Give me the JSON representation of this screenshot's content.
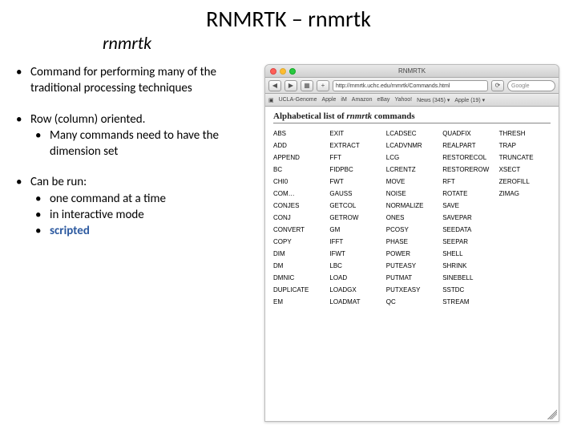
{
  "title": "RNMRTK – rnmrtk",
  "subtitle": "rnmrtk",
  "bullets": [
    {
      "text": "Command for performing many of the traditional processing techniques"
    },
    {
      "text": "Row (column) oriented.",
      "sub": [
        "Many commands need to have the dimension set"
      ]
    },
    {
      "text": "Can be run:",
      "sub": [
        "one command at a time",
        "in interactive mode",
        {
          "text": "scripted",
          "cls": "scripted"
        }
      ]
    }
  ],
  "browser": {
    "window_title": "RNMRTK",
    "url": "http://rnmrtk.uchc.edu/rnmrtk/Commands.html",
    "search_placeholder": "Google",
    "bookmarks": [
      "UCLA-Genome",
      "Apple",
      "iM",
      "Amazon",
      "eBay",
      "Yahoo!",
      "News (345) ▾",
      "Apple (19) ▾"
    ],
    "page_heading_pre": "Alphabetical list of ",
    "page_heading_ital": "rnmrtk",
    "page_heading_post": " commands",
    "commands": [
      "ABS",
      "ADD",
      "APPEND",
      "BC",
      "CHI0",
      "COM…",
      "CONJES",
      "CONJ",
      "CONVERT",
      "COPY",
      "DIM",
      "DM",
      "DMNIC",
      "DUPLICATE",
      "EM",
      "",
      "EXIT",
      "EXTRACT",
      "FFT",
      "FIDPBC",
      "FWT",
      "GAUSS",
      "GETCOL",
      "GETROW",
      "GM",
      "IFFT",
      "IFWT",
      "LBC",
      "LOAD",
      "LOADGX",
      "LOADMAT",
      "",
      "LCADSEC",
      "LCADVNMR",
      "LCG",
      "LCRENTZ",
      "MOVE",
      "NOISE",
      "NORMALIZE",
      "ONES",
      "PCOSY",
      "PHASE",
      "POWER",
      "PUTEASY",
      "PUTMAT",
      "PUTXEASY",
      "QC",
      "",
      "QUADFIX",
      "REALPART",
      "RESTORECOL",
      "RESTOREROW",
      "RFT",
      "ROTATE",
      "SAVE",
      "SAVEPAR",
      "SEEDATA",
      "SEEPAR",
      "SHELL",
      "SHRINK",
      "SINEBELL",
      "SSTDC",
      "STREAM",
      "",
      "THRESH",
      "TRAP",
      "TRUNCATE",
      "XSECT",
      "ZEROFILL",
      "ZIMAG",
      "",
      "",
      "",
      "",
      "",
      "",
      "",
      "",
      "",
      ""
    ]
  }
}
